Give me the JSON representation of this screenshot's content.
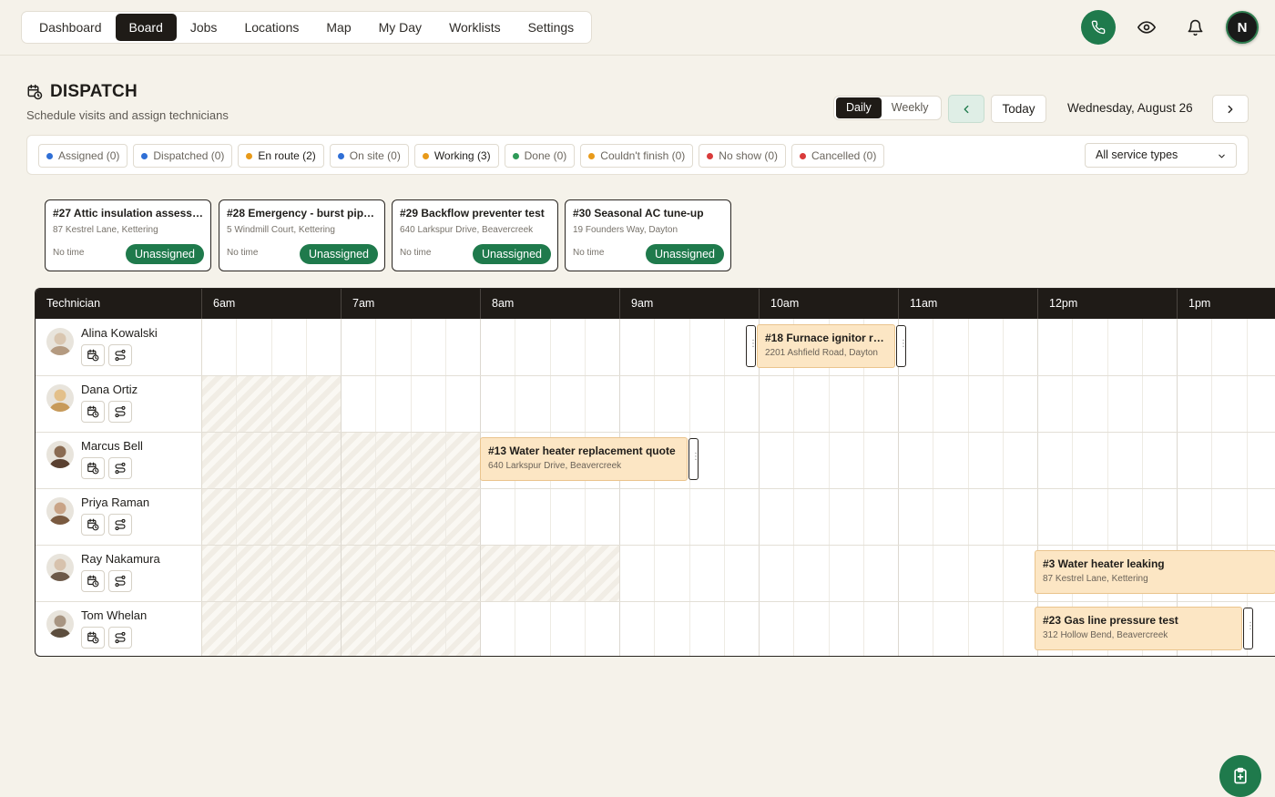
{
  "nav": {
    "tabs": [
      {
        "label": "Dashboard"
      },
      {
        "label": "Board",
        "active": true
      },
      {
        "label": "Jobs"
      },
      {
        "label": "Locations"
      },
      {
        "label": "Map"
      },
      {
        "label": "My Day"
      },
      {
        "label": "Worklists"
      },
      {
        "label": "Settings"
      }
    ],
    "user_initial": "N"
  },
  "header": {
    "title": "DISPATCH",
    "subtitle": "Schedule visits and assign technicians",
    "view_options": [
      "Daily",
      "Weekly"
    ],
    "active_view": "Daily",
    "today_label": "Today",
    "date_label": "Wednesday, August 26"
  },
  "filters": {
    "statuses": [
      {
        "label": "Assigned (0)",
        "color": "#2f6fd6"
      },
      {
        "label": "Dispatched (0)",
        "color": "#2f6fd6"
      },
      {
        "label": "En route (2)",
        "color": "#e89a1a",
        "strong": true
      },
      {
        "label": "On site (0)",
        "color": "#2f6fd6"
      },
      {
        "label": "Working (3)",
        "color": "#e89a1a",
        "strong": true
      },
      {
        "label": "Done (0)",
        "color": "#2e9a58"
      },
      {
        "label": "Couldn't finish (0)",
        "color": "#e89a1a"
      },
      {
        "label": "No show (0)",
        "color": "#d93b3b"
      },
      {
        "label": "Cancelled (0)",
        "color": "#d93b3b"
      }
    ],
    "service_select": "All service types"
  },
  "unassigned": [
    {
      "title": "#27 Attic insulation assessm...",
      "address": "87 Kestrel Lane, Kettering",
      "time": "No time",
      "badge": "Unassigned"
    },
    {
      "title": "#28 Emergency - burst pipe ...",
      "address": "5 Windmill Court, Kettering",
      "time": "No time",
      "badge": "Unassigned"
    },
    {
      "title": "#29 Backflow preventer test",
      "address": "640 Larkspur Drive, Beavercreek",
      "time": "No time",
      "badge": "Unassigned"
    },
    {
      "title": "#30 Seasonal AC tune-up",
      "address": "19 Founders Way, Dayton",
      "time": "No time",
      "badge": "Unassigned"
    }
  ],
  "board": {
    "tech_header": "Technician",
    "hours": [
      "6am",
      "7am",
      "8am",
      "9am",
      "10am",
      "11am",
      "12pm",
      "1pm"
    ],
    "technicians": [
      {
        "name": "Alina Kowalski"
      },
      {
        "name": "Dana Ortiz"
      },
      {
        "name": "Marcus Bell"
      },
      {
        "name": "Priya Raman"
      },
      {
        "name": "Ray Nakamura"
      },
      {
        "name": "Tom Whelan"
      }
    ],
    "jobs": [
      {
        "title": "#18 Furnace ignitor re...",
        "address": "2201 Ashfield Road, Dayton"
      },
      {
        "title": "#13 Water heater replacement quote",
        "address": "640 Larkspur Drive, Beavercreek"
      },
      {
        "title": "#3 Water heater leaking",
        "address": "87 Kestrel Lane, Kettering"
      },
      {
        "title": "#23 Gas line pressure test",
        "address": "312 Hollow Bend, Beavercreek"
      }
    ]
  },
  "colors": {
    "accent_green": "#1f7a4c",
    "header_dark": "#1f1b17",
    "job_fill": "#fce6c4"
  }
}
